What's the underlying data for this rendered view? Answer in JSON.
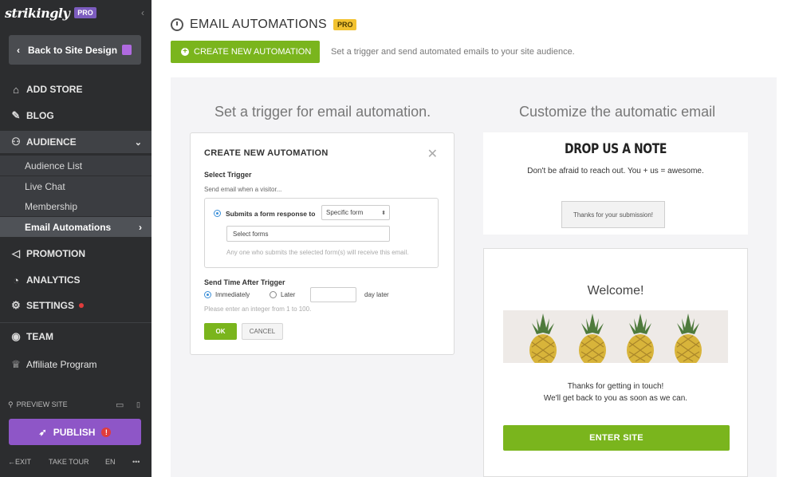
{
  "brand": {
    "logo": "strikingly",
    "badge": "PRO"
  },
  "sidebar": {
    "back_label": "Back to Site Design",
    "items": [
      {
        "label": "ADD STORE",
        "icon": "store-icon"
      },
      {
        "label": "BLOG",
        "icon": "pen-icon"
      },
      {
        "label": "AUDIENCE",
        "icon": "users-icon"
      },
      {
        "label": "PROMOTION",
        "icon": "megaphone-icon"
      },
      {
        "label": "ANALYTICS",
        "icon": "pie-chart-icon"
      },
      {
        "label": "SETTINGS",
        "icon": "gear-icon"
      },
      {
        "label": "TEAM",
        "icon": "team-icon"
      },
      {
        "label": "Affiliate Program",
        "icon": "trophy-icon"
      }
    ],
    "sub_items": [
      "Audience List",
      "Live Chat",
      "Membership",
      "Email Automations"
    ],
    "preview_label": "PREVIEW SITE",
    "publish_label": "PUBLISH",
    "publish_alert": "!",
    "footer": {
      "exit": "EXIT",
      "tour": "TAKE TOUR",
      "lang": "EN",
      "more": "•••"
    }
  },
  "header": {
    "title": "EMAIL AUTOMATIONS",
    "badge": "PRO",
    "create_label": "CREATE NEW AUTOMATION",
    "create_desc": "Set a trigger and send automated emails to your site audience."
  },
  "left_col": {
    "title": "Set a trigger for email automation.",
    "card": {
      "title": "CREATE NEW AUTOMATION",
      "select_trigger": "Select Trigger",
      "send_when": "Send email when a visitor...",
      "submits_label": "Submits a form response to",
      "form_type": "Specific form",
      "forms_placeholder": "Select forms",
      "forms_hint": "Any one who submits the selected form(s) will receive this email.",
      "send_time": "Send Time After Trigger",
      "immediately": "Immediately",
      "later": "Later",
      "day_later": "day later",
      "integer_hint": "Please enter an integer  from 1 to 100.",
      "ok": "OK",
      "cancel": "CANCEL"
    }
  },
  "right_col": {
    "title": "Customize the automatic email",
    "note": {
      "title": "DROP US A NOTE",
      "subtitle": "Don't be afraid to reach out. You + us = awesome.",
      "button": "Thanks for your submission!"
    },
    "welcome": {
      "title": "Welcome!",
      "line1": "Thanks for getting in touch!",
      "line2": "We'll get back to you as soon as we can.",
      "button": "ENTER SITE"
    }
  },
  "colors": {
    "sidebar": "#2c2d2f",
    "accent_green": "#7ab51d",
    "accent_purple": "#8e56c7",
    "pro_yellow": "#f2c230"
  }
}
